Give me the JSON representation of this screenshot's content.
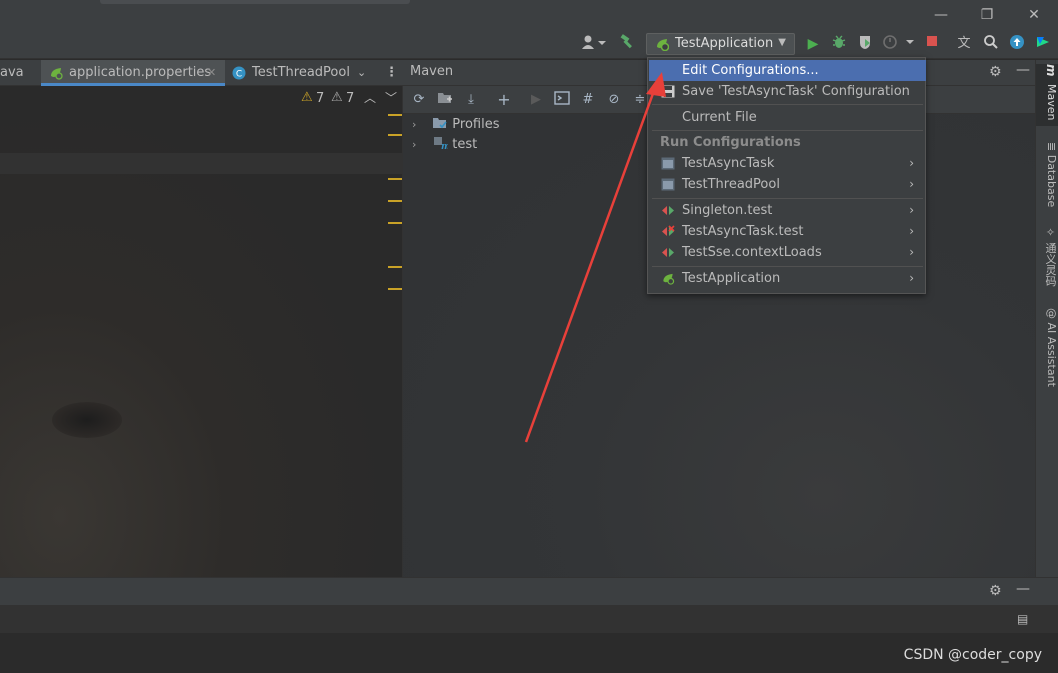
{
  "window": {
    "minimize": "—",
    "restore": "❐",
    "close": "✕"
  },
  "toolbar": {
    "run_config_label": "TestApplication"
  },
  "editor": {
    "tabs": [
      {
        "label": "ava"
      },
      {
        "label": "application.properties"
      },
      {
        "label": "TestThreadPool"
      }
    ],
    "warnings_a": "7",
    "warnings_b": "7"
  },
  "maven": {
    "title": "Maven",
    "tree": [
      {
        "label": "Profiles"
      },
      {
        "label": "test"
      }
    ]
  },
  "menu": {
    "items_top": [
      {
        "label": "Edit Configurations..."
      },
      {
        "label": "Save 'TestAsyncTask' Configuration"
      },
      {
        "label": "Current File"
      }
    ],
    "section_label": "Run Configurations",
    "run_configs": [
      {
        "label": "TestAsyncTask"
      },
      {
        "label": "TestThreadPool"
      },
      {
        "label": "Singleton.test"
      },
      {
        "label": "TestAsyncTask.test"
      },
      {
        "label": "TestSse.contextLoads"
      },
      {
        "label": "TestApplication"
      }
    ]
  },
  "right_tabs": [
    {
      "label": "Maven"
    },
    {
      "label": "Database"
    },
    {
      "label": "通义灵码"
    },
    {
      "label": "AI Assistant"
    }
  ],
  "watermark": "CSDN @coder_copy",
  "colors": {
    "accent_selection": "#4b6eaf",
    "annotation_arrow": "#e8403a",
    "run_green": "#4caf50",
    "stop_red": "#d9534f"
  }
}
